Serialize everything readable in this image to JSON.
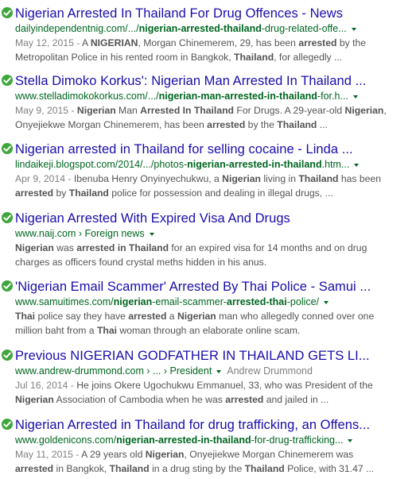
{
  "results": [
    {
      "title": "Nigerian Arrested In Thailand For Drug Offences - News",
      "url_parts": [
        {
          "t": "dailyindependentnig.com/.../",
          "b": false
        },
        {
          "t": "nigerian-arrested-thailand",
          "b": true
        },
        {
          "t": "-drug-related-offe...",
          "b": false
        }
      ],
      "snippet_lines": [
        [
          {
            "t": "May 12, 2015 - ",
            "s": "date"
          },
          {
            "t": "A ",
            "s": ""
          },
          {
            "t": "NIGERIAN",
            "s": "b"
          },
          {
            "t": ", Morgan Chinemerem, 29, has been ",
            "s": ""
          },
          {
            "t": "arrested",
            "s": "b"
          },
          {
            "t": " by the",
            "s": ""
          }
        ],
        [
          {
            "t": "Metropolitan Police in his rented room in Bangkok, ",
            "s": ""
          },
          {
            "t": "Thailand",
            "s": "b"
          },
          {
            "t": ", for allegedly ...",
            "s": ""
          }
        ]
      ]
    },
    {
      "title": "Stella Dimoko Korkus': Nigerian Man Arrested In Thailand ...",
      "url_parts": [
        {
          "t": "www.stelladimokokorkus.com/.../",
          "b": false
        },
        {
          "t": "nigerian-man-arrested-in-thailand",
          "b": true
        },
        {
          "t": "-for.h...",
          "b": false
        }
      ],
      "snippet_lines": [
        [
          {
            "t": "May 9, 2015 - ",
            "s": "date"
          },
          {
            "t": "Nigerian",
            "s": "b"
          },
          {
            "t": " Man ",
            "s": ""
          },
          {
            "t": "Arrested In Thailand",
            "s": "b"
          },
          {
            "t": " For Drugs. A 29-year-old ",
            "s": ""
          },
          {
            "t": "Nigerian",
            "s": "b"
          },
          {
            "t": ",",
            "s": ""
          }
        ],
        [
          {
            "t": "Onyejiekwe Morgan Chinemerem, has been ",
            "s": ""
          },
          {
            "t": "arrested",
            "s": "b"
          },
          {
            "t": " by the ",
            "s": ""
          },
          {
            "t": "Thailand",
            "s": "b"
          },
          {
            "t": " ...",
            "s": ""
          }
        ]
      ]
    },
    {
      "title": "Nigerian arrested in Thailand for selling cocaine - Linda ...",
      "url_parts": [
        {
          "t": "lindaikeji.blogspot.com/2014/.../photos-",
          "b": false
        },
        {
          "t": "nigerian-arrested-in-thailand",
          "b": true
        },
        {
          "t": ".htm...",
          "b": false
        }
      ],
      "snippet_lines": [
        [
          {
            "t": "Apr 9, 2014 - ",
            "s": "date"
          },
          {
            "t": "Ibenuba Henry Onyinyechukwu, a ",
            "s": ""
          },
          {
            "t": "Nigerian",
            "s": "b"
          },
          {
            "t": " living in ",
            "s": ""
          },
          {
            "t": "Thailand",
            "s": "b"
          },
          {
            "t": " has been",
            "s": ""
          }
        ],
        [
          {
            "t": "arrested",
            "s": "b"
          },
          {
            "t": " by ",
            "s": ""
          },
          {
            "t": "Thailand",
            "s": "b"
          },
          {
            "t": " police for possession and dealing in illegal drugs, ...",
            "s": ""
          }
        ]
      ]
    },
    {
      "title": "Nigerian Arrested With Expired Visa And Drugs",
      "url_parts": [
        {
          "t": "www.naij.com",
          "b": false
        },
        {
          "t": " › Foreign news",
          "b": false
        }
      ],
      "snippet_lines": [
        [
          {
            "t": "Nigerian",
            "s": "b"
          },
          {
            "t": " was ",
            "s": ""
          },
          {
            "t": "arrested in Thailand",
            "s": "b"
          },
          {
            "t": " for an expired visa for 14 months and on drug",
            "s": ""
          }
        ],
        [
          {
            "t": "charges as officers found crystal meths hidden in his anus.",
            "s": ""
          }
        ]
      ]
    },
    {
      "title": "'Nigerian Email Scammer' Arrested By Thai Police - Samui ...",
      "url_parts": [
        {
          "t": "www.samuitimes.com/",
          "b": false
        },
        {
          "t": "nigerian",
          "b": true
        },
        {
          "t": "-email-scammer-",
          "b": false
        },
        {
          "t": "arrested-thai",
          "b": true
        },
        {
          "t": "-police/",
          "b": false
        }
      ],
      "snippet_lines": [
        [
          {
            "t": "Thai",
            "s": "b"
          },
          {
            "t": " police say they have ",
            "s": ""
          },
          {
            "t": "arrested",
            "s": "b"
          },
          {
            "t": " a ",
            "s": ""
          },
          {
            "t": "Nigerian",
            "s": "b"
          },
          {
            "t": " man who allegedly conned over one",
            "s": ""
          }
        ],
        [
          {
            "t": "million baht from a ",
            "s": ""
          },
          {
            "t": "Thai",
            "s": "b"
          },
          {
            "t": " woman through an elaborate online scam.",
            "s": ""
          }
        ]
      ]
    },
    {
      "title": "Previous NIGERIAN GODFATHER IN THAILAND GETS LI...",
      "url_parts": [
        {
          "t": "www.andrew-drummond.com › ... › President",
          "b": false
        }
      ],
      "url_extra": "Andrew Drummond",
      "snippet_lines": [
        [
          {
            "t": "Jul 16, 2014 - ",
            "s": "date"
          },
          {
            "t": "He joins Okere Ugochukwu Emmanuel, 33, who was President of the",
            "s": ""
          }
        ],
        [
          {
            "t": "Nigerian",
            "s": "b"
          },
          {
            "t": " Association of Cambodia when he was ",
            "s": ""
          },
          {
            "t": "arrested",
            "s": "b"
          },
          {
            "t": " and jailed in ...",
            "s": ""
          }
        ]
      ]
    },
    {
      "title": "Nigerian Arrested in Thailand for drug trafficking, an Offens...",
      "url_parts": [
        {
          "t": "www.goldenicons.com/",
          "b": false
        },
        {
          "t": "nigerian-arrested-in-thailand",
          "b": true
        },
        {
          "t": "-for-drug-trafficking...",
          "b": false
        }
      ],
      "snippet_lines": [
        [
          {
            "t": "May 11, 2015 - ",
            "s": "date"
          },
          {
            "t": "A 29 years old ",
            "s": ""
          },
          {
            "t": "Nigerian",
            "s": "b"
          },
          {
            "t": ", Onyejiekwe Morgan Chinemerem was",
            "s": ""
          }
        ],
        [
          {
            "t": "arrested",
            "s": "b"
          },
          {
            "t": " in Bangkok, ",
            "s": ""
          },
          {
            "t": "Thailand",
            "s": "b"
          },
          {
            "t": " in a drug sting by the ",
            "s": ""
          },
          {
            "t": "Thailand",
            "s": "b"
          },
          {
            "t": " Police, with 31.47 ...",
            "s": ""
          }
        ]
      ]
    }
  ],
  "colors": {
    "title": "#1a0dab",
    "url": "#006621",
    "snippet": "#545454",
    "date": "#808080",
    "check": "#3fa63c"
  },
  "icons": {
    "verified": "check-circle-icon",
    "dropdown": "caret-down-icon"
  }
}
